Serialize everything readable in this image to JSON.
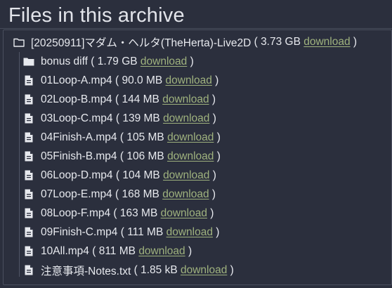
{
  "heading": "Files in this archive",
  "root": {
    "name": "[20250911]マダム・ヘルタ(TheHerta)-Live2D",
    "size": "3.73 GB",
    "download_label": "download",
    "icon": "folder-outline-icon"
  },
  "items": [
    {
      "type": "folder",
      "name": "bonus diff",
      "size": "1.79 GB",
      "download_label": "download",
      "icon": "folder-icon"
    },
    {
      "type": "file",
      "name": "01Loop-A.mp4",
      "size": "90.0 MB",
      "download_label": "download",
      "icon": "file-icon"
    },
    {
      "type": "file",
      "name": "02Loop-B.mp4",
      "size": "144 MB",
      "download_label": "download",
      "icon": "file-icon"
    },
    {
      "type": "file",
      "name": "03Loop-C.mp4",
      "size": "139 MB",
      "download_label": "download",
      "icon": "file-icon"
    },
    {
      "type": "file",
      "name": "04Finish-A.mp4",
      "size": "105 MB",
      "download_label": "download",
      "icon": "file-icon"
    },
    {
      "type": "file",
      "name": "05Finish-B.mp4",
      "size": "106 MB",
      "download_label": "download",
      "icon": "file-icon"
    },
    {
      "type": "file",
      "name": "06Loop-D.mp4",
      "size": "104 MB",
      "download_label": "download",
      "icon": "file-icon"
    },
    {
      "type": "file",
      "name": "07Loop-E.mp4",
      "size": "168 MB",
      "download_label": "download",
      "icon": "file-icon"
    },
    {
      "type": "file",
      "name": "08Loop-F.mp4",
      "size": "163 MB",
      "download_label": "download",
      "icon": "file-icon"
    },
    {
      "type": "file",
      "name": "09Finish-C.mp4",
      "size": "111 MB",
      "download_label": "download",
      "icon": "file-icon"
    },
    {
      "type": "file",
      "name": "10All.mp4",
      "size": "811 MB",
      "download_label": "download",
      "icon": "file-icon"
    },
    {
      "type": "file",
      "name": "注意事項-Notes.txt",
      "size": "1.85 kB",
      "download_label": "download",
      "icon": "file-icon"
    }
  ],
  "colors": {
    "background": "#2b2f3d",
    "text": "#e7e9ee",
    "link": "#9fb27e",
    "border": "#4a4f5e"
  }
}
